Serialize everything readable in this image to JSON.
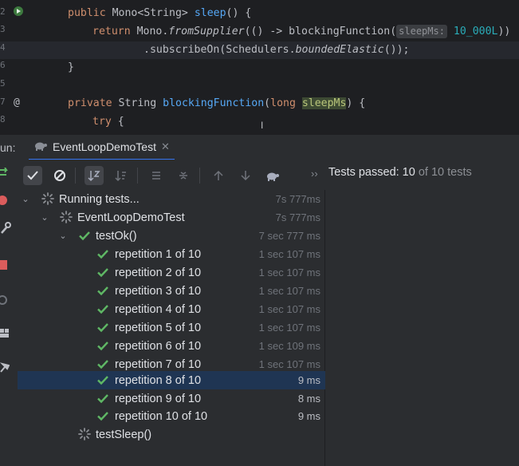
{
  "editor": {
    "lines": [
      {
        "num": "2",
        "top_text": "public Mono<String> sleep() {"
      },
      {
        "num": "3"
      },
      {
        "num": "4"
      },
      {
        "num": "5"
      },
      {
        "num": "6"
      },
      {
        "num": "7"
      },
      {
        "num": "8"
      }
    ],
    "code": {
      "l1_public": "public",
      "l1_type": "Mono<String>",
      "l1_name": "sleep",
      "l1_rest": "() {",
      "l2_return": "return",
      "l2_mono": "Mono.",
      "l2_method": "fromSupplier",
      "l2_lambda": "(() -> blockingFunction(",
      "l2_hint": "sleepMs:",
      "l2_value": "10_000L",
      "l2_end": "))",
      "l3_sub": ".subscribeOn(Schedulers.",
      "l3_method": "boundedElastic",
      "l3_end": "());",
      "l4": "}",
      "l6_private": "private",
      "l6_type": "String",
      "l6_name": "blockingFunction",
      "l6_paren": "(",
      "l6_long": "long",
      "l6_param": "sleepMs",
      "l6_end": ") {",
      "l7_try": "try",
      "l7_brace": "{"
    }
  },
  "run": {
    "label": "un:",
    "tab_label": "EventLoopDemoTest",
    "status_main": "Tests passed: 10",
    "status_rest": "of 10 tests"
  },
  "tree": [
    {
      "label": "Running tests...",
      "time": "7s 777ms"
    },
    {
      "label": "EventLoopDemoTest",
      "time": "7s 777ms"
    },
    {
      "label": "testOk()",
      "time": "7 sec 777 ms"
    },
    {
      "label": "repetition 1 of 10",
      "time": "1 sec 107 ms"
    },
    {
      "label": "repetition 2 of 10",
      "time": "1 sec 107 ms"
    },
    {
      "label": "repetition 3 of 10",
      "time": "1 sec 107 ms"
    },
    {
      "label": "repetition 4 of 10",
      "time": "1 sec 107 ms"
    },
    {
      "label": "repetition 5 of 10",
      "time": "1 sec 107 ms"
    },
    {
      "label": "repetition 6 of 10",
      "time": "1 sec 109 ms"
    },
    {
      "label": "repetition 7 of 10",
      "time": "1 sec 107 ms"
    },
    {
      "label": "repetition 8 of 10",
      "time": "9 ms"
    },
    {
      "label": "repetition 9 of 10",
      "time": "8 ms"
    },
    {
      "label": "repetition 10 of 10",
      "time": "9 ms"
    },
    {
      "label": "testSleep()",
      "time": ""
    }
  ],
  "colors": {
    "pass_green": "#5fb865",
    "selection": "#1f3553",
    "accent": "#3574f0"
  }
}
